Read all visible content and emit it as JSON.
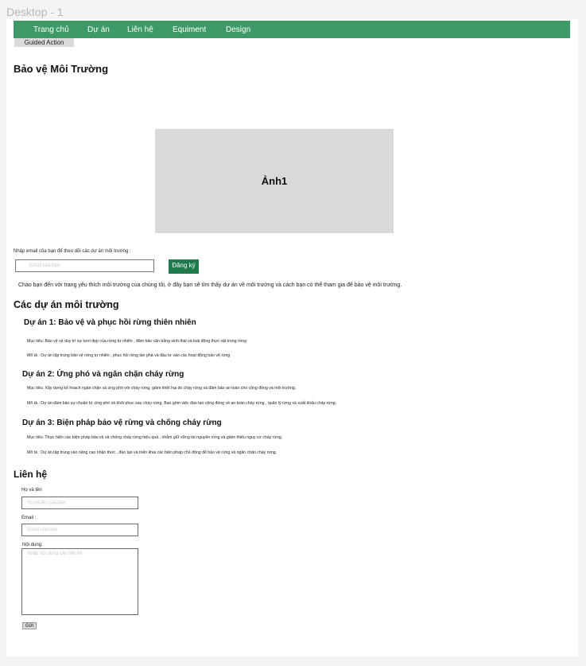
{
  "frame": {
    "title": "Desktop - 1"
  },
  "nav": {
    "items": [
      "Trang chủ",
      "Dự án",
      "Liên hệ",
      "Equiment",
      "Design"
    ]
  },
  "guided_action": "Guided Action",
  "hero": {
    "title": "Bảo vệ Môi Trường",
    "image_label": "Ảnh1"
  },
  "subscribe": {
    "label": "Nhập email của bạn để theo dõi các dự án môi trường :",
    "placeholder": "Email của bạn",
    "button": "Đăng ký"
  },
  "intro": "Chào bạn đến với trang yêu thích môi trường của chúng tôi, ở đây bạn sẽ tìm thấy dự án về môi trường  và cách bạn có thể tham gia để bảo vệ môi trường.",
  "projects": {
    "heading": "Các dự án môi trường",
    "items": [
      {
        "title": "Dự án 1: Bảo vệ và phục hồi rừng thiên nhiên",
        "goal": "Mục tiêu: Bảo vệ và duy trì sự tươi đẹp của rừng tự nhiên , đảm bảo cân bằng sinh thái và loài động thực vật trong rừng",
        "desc": "Mô tả : Dự án tập trung bảo vệ rừng tự nhiên , phục hồi rừng tàn phá và đầu tư vào các hoạt động bảo vệ rừng"
      },
      {
        "title": "Dự án 2: Ứng phó và ngăn chặn cháy rừng",
        "goal": "Mục tiêu: Xây dựng kế hoạch ngăn chặn và ứng phó với cháy rừng, giảm thiệt hại do cháy rừng  và đảm bảo an toàn cho cộng đồng và môi trường.",
        "desc": "Mô tả : Dự án đảm bảo sự chuẩn bị ,ứng phó và khôi phục sau cháy rừng. Bao gồm  việc đào tạo cộng đồng  về an toàn cháy rừng , quản lý rừng và  xuất khẩu cháy rừng."
      },
      {
        "title": "Dự án 3: Biện pháp bảo vệ rừng và chống cháy rừng",
        "goal": "Mục tiêu: Thực hiện các biện pháp bảo vệ và chống cháy rừng hiệu quả , nhằm giữ vững tài nguyên rừng  và giảm thiểu nguy cơ cháy rừng.",
        "desc": "Mô tả : Dự án tập trung vào nâng cao nhận thức , đào tạo và triển khai các biện pháp chủ động để bảo vệ rừng và ngăn chặn cháy rừng."
      }
    ]
  },
  "contact": {
    "heading": "Liên hệ",
    "name_label": "Họ và tên",
    "name_placeholder": "Họ và tên của bạn",
    "email_label": "Email :",
    "email_placeholder": "Email của bạn",
    "message_label": "Nội dung:",
    "message_placeholder": "Nhập nội dung cần liên hệ",
    "send": "Gửi"
  },
  "colors": {
    "nav_bg": "#3d9a66",
    "button_bg": "#1f7a4d"
  }
}
